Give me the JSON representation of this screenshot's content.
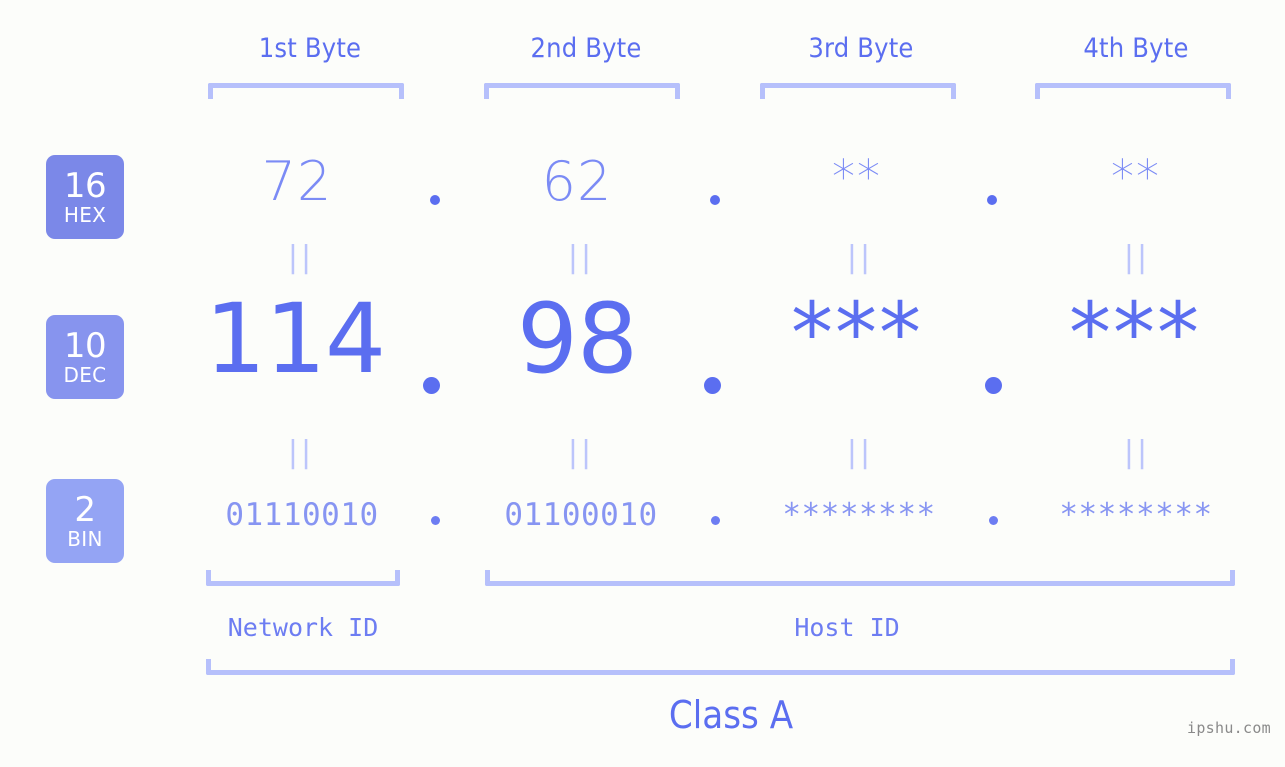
{
  "page": {
    "background_color": "#fcfdfa",
    "accent_color": "#5b6ef0",
    "light_accent_color": "#b6c0fb",
    "watermark": "ipshu.com"
  },
  "byte_headers": [
    {
      "label": "1st Byte"
    },
    {
      "label": "2nd Byte"
    },
    {
      "label": "3rd Byte"
    },
    {
      "label": "4th Byte"
    }
  ],
  "bases": [
    {
      "number": "16",
      "label": "HEX",
      "color": "#7b88e8"
    },
    {
      "number": "10",
      "label": "DEC",
      "color": "#8794ee"
    },
    {
      "number": "2",
      "label": "BIN",
      "color": "#94a4f4"
    }
  ],
  "rows": {
    "hex": {
      "values": [
        "72",
        "62",
        "**",
        "**"
      ]
    },
    "dec": {
      "values": [
        "114",
        "98",
        "***",
        "***"
      ]
    },
    "bin": {
      "values": [
        "01110010",
        "01100010",
        "********",
        "********"
      ]
    }
  },
  "separators": {
    "dot": ".",
    "equals_marker": "||"
  },
  "groups": {
    "network_id": "Network ID",
    "host_id": "Host ID",
    "class": "Class A"
  }
}
